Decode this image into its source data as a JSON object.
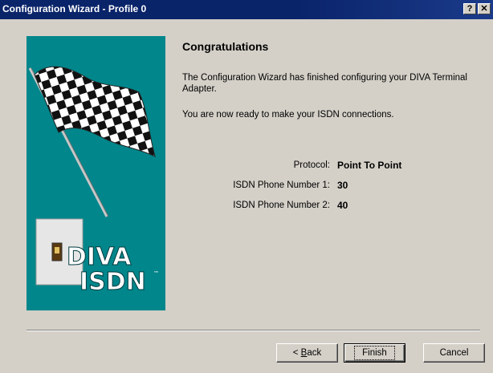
{
  "window": {
    "title": "Configuration Wizard - Profile 0",
    "help_label": "?",
    "close_label": "✕"
  },
  "graphic": {
    "logo_text_top": "DIVA",
    "logo_text_bottom": "ISDN",
    "trademark": "™",
    "background_color": "#00868b"
  },
  "main": {
    "heading": "Congratulations",
    "paragraph1": "The Configuration Wizard has finished configuring your DIVA Terminal Adapter.",
    "paragraph2": "You are now ready to make your ISDN connections."
  },
  "details": [
    {
      "label": "Protocol:",
      "value": "Point To Point"
    },
    {
      "label": "ISDN Phone Number 1:",
      "value": "30"
    },
    {
      "label": "ISDN Phone Number 2:",
      "value": "40"
    }
  ],
  "buttons": {
    "back_prefix": "< ",
    "back_mnemonic": "B",
    "back_rest": "ack",
    "finish": "Finish",
    "cancel": "Cancel"
  }
}
